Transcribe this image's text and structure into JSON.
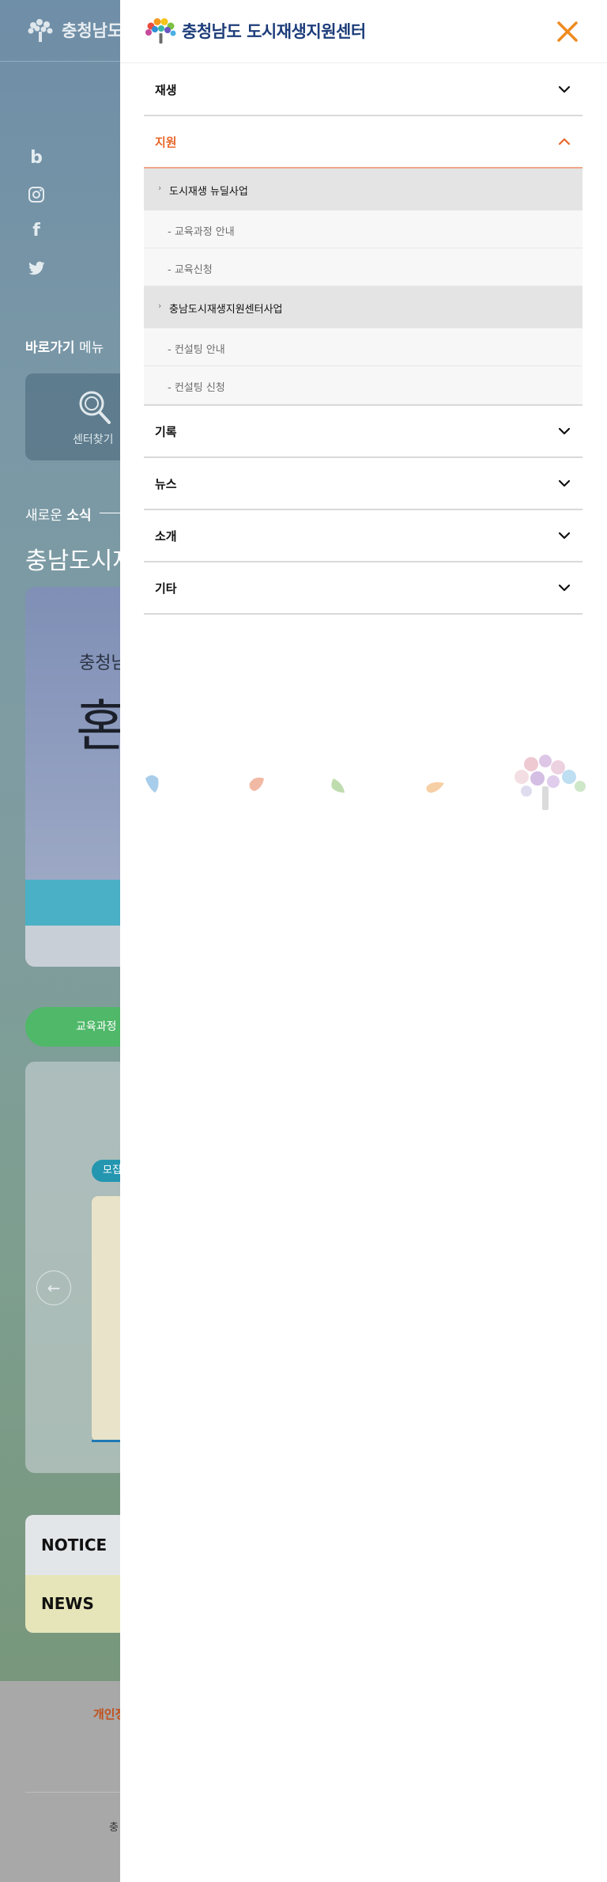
{
  "background": {
    "logo_text": "충청남도",
    "shortcut_title_bold": "바로가기",
    "shortcut_title_rest": " 메뉴",
    "shortcut_label": "센터찾기",
    "news_title_rest": "새로운 ",
    "news_title_bold": "소식",
    "big_title": "충남도시재",
    "banner_sub": "충청남",
    "banner_big": "혼",
    "green_pill": "교육과정",
    "tag": "모집",
    "notice": "NOTICE",
    "news": "NEWS",
    "footer_link": "개인정",
    "footer_text": "충"
  },
  "drawer": {
    "logo_text": "충청남도 도시재생지원센터",
    "menu": [
      {
        "label": "재생",
        "open": false
      },
      {
        "label": "지원",
        "open": true
      },
      {
        "label": "기록",
        "open": false
      },
      {
        "label": "뉴스",
        "open": false
      },
      {
        "label": "소개",
        "open": false
      },
      {
        "label": "기타",
        "open": false
      }
    ],
    "submenu": [
      {
        "heading": "도시재생 뉴딜사업",
        "links": [
          "- 교육과정 안내",
          "- 교육신청"
        ]
      },
      {
        "heading": "충남도시재생지원센터사업",
        "links": [
          "- 컨설팅 안내",
          "- 컨설팅 신청"
        ]
      }
    ]
  },
  "colors": {
    "accent": "#e8672c",
    "brand_navy": "#1d3d7a",
    "close_orange": "#ef8b1f"
  },
  "icons": {
    "close": "close-icon",
    "chevron_down": "chevron-down-icon",
    "chevron_up": "chevron-up-icon"
  }
}
